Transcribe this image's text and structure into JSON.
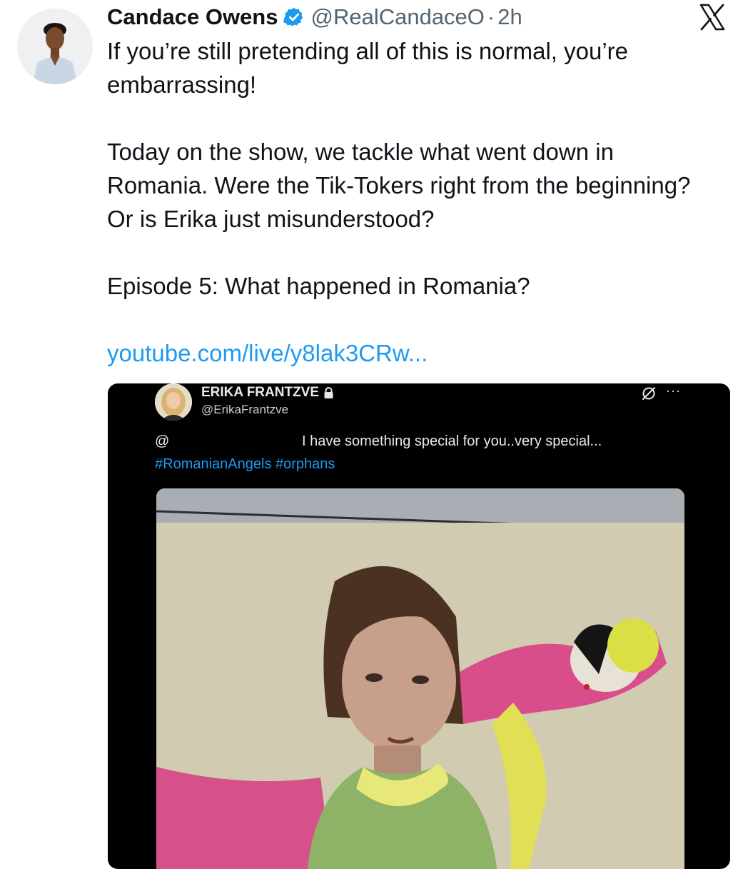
{
  "tweet": {
    "author_name": "Candace Owens",
    "handle": "@RealCandaceO",
    "separator": "·",
    "time": "2h",
    "lines": [
      "If you’re still pretending all of this is normal, you’re embarrassing!",
      "Today on the show, we tackle what went down in Romania. Were the Tik-Tokers right from the beginning? Or is Erika just misunderstood?",
      "Episode 5: What happened in Romania?"
    ],
    "link": "youtube.com/live/y8lak3CRw..."
  },
  "embedded_tweet": {
    "author_name": "ERIKA FRANTZVE",
    "handle": "@ErikaFrantzve",
    "mention": "@",
    "text": "I have something special for you..very special...",
    "hashtags": "#RomanianAngels #orphans",
    "more_label": "···"
  },
  "icons": {
    "verified": "verified-badge-icon",
    "brand": "x-logo-icon",
    "lock": "lock-icon",
    "grok": "grok-icon"
  },
  "colors": {
    "text": "#0f1419",
    "secondary": "#536471",
    "link": "#1d9bf0",
    "embed_bg": "#000000"
  }
}
